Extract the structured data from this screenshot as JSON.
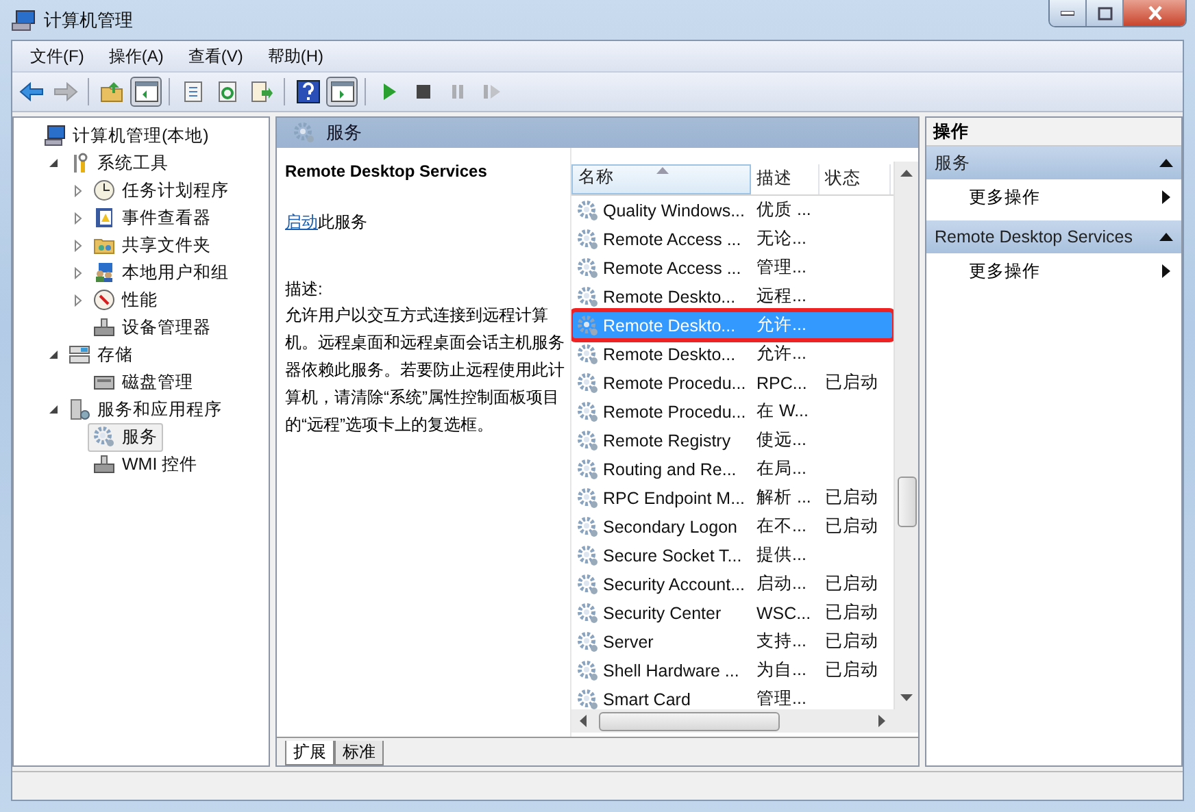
{
  "window": {
    "title": "计算机管理",
    "controls": [
      {
        "kind": "minimize"
      },
      {
        "kind": "maximize"
      },
      {
        "kind": "close"
      }
    ]
  },
  "menu": [
    "文件(F)",
    "操作(A)",
    "查看(V)",
    "帮助(H)"
  ],
  "toolbar_groups": [
    {
      "buttons": [
        {
          "kind": "back",
          "disabled": false,
          "pressed": false
        },
        {
          "kind": "forward",
          "disabled": true,
          "pressed": false
        }
      ]
    },
    {
      "buttons": [
        {
          "kind": "up",
          "disabled": false,
          "pressed": false
        },
        {
          "kind": "tree-toggle",
          "disabled": false,
          "pressed": true
        }
      ]
    },
    {
      "buttons": [
        {
          "kind": "properties",
          "disabled": false,
          "pressed": false
        },
        {
          "kind": "refresh",
          "disabled": false,
          "pressed": false
        },
        {
          "kind": "export",
          "disabled": false,
          "pressed": false
        }
      ]
    },
    {
      "buttons": [
        {
          "kind": "help",
          "disabled": false,
          "pressed": false
        },
        {
          "kind": "actions-toggle",
          "disabled": false,
          "pressed": true
        }
      ]
    },
    {
      "buttons": [
        {
          "kind": "start",
          "disabled": false,
          "pressed": false
        },
        {
          "kind": "stop",
          "disabled": false,
          "pressed": false
        },
        {
          "kind": "pause",
          "disabled": true,
          "pressed": false
        },
        {
          "kind": "resume",
          "disabled": true,
          "pressed": false
        }
      ]
    }
  ],
  "tree": [
    {
      "label": "计算机管理(本地)",
      "selected": false,
      "children": [
        {
          "label": "系统工具",
          "expanded": true,
          "selected": false,
          "children": [
            {
              "label": "任务计划程序",
              "expanded": false,
              "selected": false
            },
            {
              "label": "事件查看器",
              "expanded": false,
              "selected": false
            },
            {
              "label": "共享文件夹",
              "expanded": false,
              "selected": false
            },
            {
              "label": "本地用户和组",
              "expanded": false,
              "selected": false
            },
            {
              "label": "性能",
              "expanded": false,
              "selected": false
            },
            {
              "label": "设备管理器",
              "selected": false
            }
          ]
        },
        {
          "label": "存储",
          "expanded": true,
          "selected": false,
          "children": [
            {
              "label": "磁盘管理",
              "selected": false
            }
          ]
        },
        {
          "label": "服务和应用程序",
          "expanded": true,
          "selected": false,
          "children": [
            {
              "label": "服务",
              "selected": true
            },
            {
              "label": "WMI 控件",
              "selected": false
            }
          ]
        }
      ]
    }
  ],
  "center": {
    "header": "服务",
    "detail": {
      "title": "Remote Desktop Services",
      "action_link": "启动",
      "action_text": "此服务",
      "description_label": "描述:",
      "description": "允许用户以交互方式连接到远程计算机。远程桌面和远程桌面会话主机服务器依赖此服务。若要防止远程使用此计算机，请清除“系统”属性控制面板项目的“远程”选项卡上的复选框。"
    },
    "table": {
      "columns": [
        {
          "label": "名称",
          "sorted": true
        },
        {
          "label": "描述",
          "sorted": false
        },
        {
          "label": "状态",
          "sorted": false
        }
      ],
      "rows": [
        {
          "name": "Quality Windows...",
          "description": "优质 ...",
          "selected": false,
          "highlighted": false
        },
        {
          "name": "Remote Access ...",
          "description": "无论...",
          "selected": false,
          "highlighted": false
        },
        {
          "name": "Remote Access ...",
          "description": "管理...",
          "selected": false,
          "highlighted": false
        },
        {
          "name": "Remote Deskto...",
          "description": "远程...",
          "selected": false,
          "highlighted": false
        },
        {
          "name": "Remote Deskto...",
          "description": "允许...",
          "selected": true,
          "highlighted": true
        },
        {
          "name": "Remote Deskto...",
          "description": "允许...",
          "selected": false,
          "highlighted": false
        },
        {
          "name": "Remote Procedu...",
          "description": "RPC...",
          "status": "已启动",
          "selected": false,
          "highlighted": false
        },
        {
          "name": "Remote Procedu...",
          "description": "在 W...",
          "selected": false,
          "highlighted": false
        },
        {
          "name": "Remote Registry",
          "description": "使远...",
          "selected": false,
          "highlighted": false
        },
        {
          "name": "Routing and Re...",
          "description": "在局...",
          "selected": false,
          "highlighted": false
        },
        {
          "name": "RPC Endpoint M...",
          "description": "解析 ...",
          "status": "已启动",
          "selected": false,
          "highlighted": false
        },
        {
          "name": "Secondary Logon",
          "description": "在不...",
          "status": "已启动",
          "selected": false,
          "highlighted": false
        },
        {
          "name": "Secure Socket T...",
          "description": "提供...",
          "selected": false,
          "highlighted": false
        },
        {
          "name": "Security Account...",
          "description": "启动...",
          "status": "已启动",
          "selected": false,
          "highlighted": false
        },
        {
          "name": "Security Center",
          "description": "WSC...",
          "status": "已启动",
          "selected": false,
          "highlighted": false
        },
        {
          "name": "Server",
          "description": "支持...",
          "status": "已启动",
          "selected": false,
          "highlighted": false
        },
        {
          "name": "Shell Hardware ...",
          "description": "为自...",
          "status": "已启动",
          "selected": false,
          "highlighted": false
        },
        {
          "name": "Smart Card",
          "description": "管理...",
          "selected": false,
          "highlighted": false
        }
      ]
    },
    "tabs": [
      {
        "label": "扩展",
        "selected": true
      },
      {
        "label": "标准",
        "selected": false
      }
    ]
  },
  "actions": {
    "title": "操作",
    "sections": [
      {
        "title": "服务",
        "expanded": true,
        "items": [
          "更多操作"
        ]
      },
      {
        "title": "Remote Desktop Services",
        "expanded": true,
        "items": [
          "更多操作"
        ]
      }
    ]
  }
}
